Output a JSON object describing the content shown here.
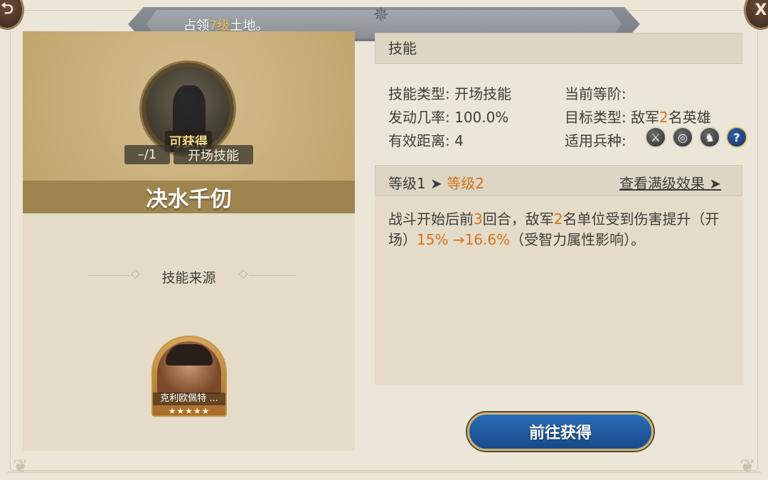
{
  "banner": {
    "prefix": "占领",
    "level": "7级",
    "suffix": "土地。"
  },
  "buttons": {
    "back_icon": "back-arrow-icon",
    "close_label": "X"
  },
  "skill": {
    "obtain_label": "可获得",
    "level_tag": "–/1",
    "type_tag": "开场技能",
    "name": "决水千仞"
  },
  "source": {
    "title": "技能来源",
    "hero_name": "克利欧佩特 ...",
    "stars": "★★★★★"
  },
  "details": {
    "header": "技能",
    "skill_type_label": "技能类型:",
    "skill_type_value": "开场技能",
    "current_tier_label": "当前等阶:",
    "current_tier_value": "",
    "trigger_label": "发动几率:",
    "trigger_value": "100.0%",
    "target_label": "目标类型:",
    "target_prefix": "敌军",
    "target_count": "2",
    "target_suffix": "名英雄",
    "range_label": "有效距离:",
    "range_value": "4",
    "unit_label": "适用兵种:",
    "unit_icons": [
      "sword-icon",
      "archery-target-icon",
      "horse-icon",
      "help-icon"
    ]
  },
  "levels": {
    "from": "等级1",
    "to": "等级2",
    "view_max": "查看满级效果"
  },
  "description": {
    "p1": "战斗开始后前",
    "n1": "3",
    "p2": "回合，敌军",
    "n2": "2",
    "p3": "名单位受到伤害提升（开场）",
    "pct_from": "15%",
    "arrow": " →",
    "pct_to": "16.6%",
    "p4": "（受智力属性影响）。"
  },
  "action": {
    "label": "前往获得"
  },
  "colors": {
    "accent_orange": "#d1741f",
    "button_blue": "#2a6cb8",
    "name_bar": "#9f8450"
  }
}
